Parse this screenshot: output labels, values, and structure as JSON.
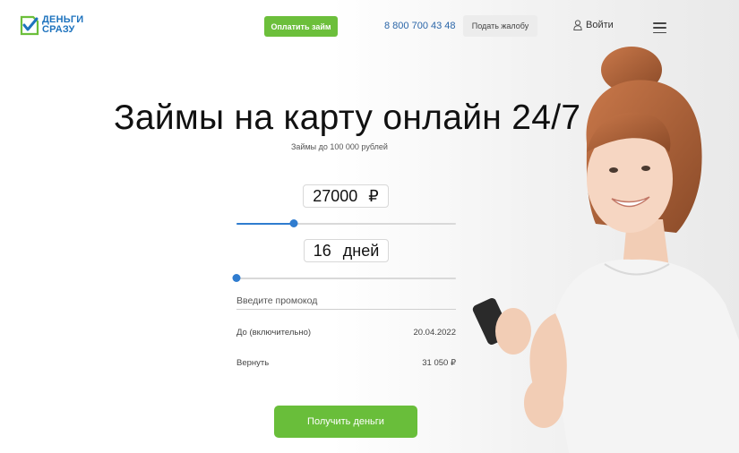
{
  "header": {
    "logo_line1": "ДЕНЬГИ",
    "logo_line2": "СРАЗУ",
    "pay_button": "Оплатить займ",
    "phone": "8 800 700 43 48",
    "complaint_button": "Подать жалобу",
    "login": "Войти"
  },
  "hero": {
    "title": "Займы на карту онлайн 24/7",
    "subtitle": "Займы до 100 000 рублей"
  },
  "calculator": {
    "amount": "27000",
    "currency": "₽",
    "amount_fraction": 0.26,
    "days": "16",
    "days_unit": "дней",
    "days_fraction": 0.0,
    "promo_placeholder": "Введите промокод",
    "due_label": "До (включительно)",
    "due_value": "20.04.2022",
    "return_label": "Вернуть",
    "return_value": "31 050 ₽",
    "submit": "Получить деньги"
  },
  "colors": {
    "accent_green": "#6cbf3b",
    "accent_blue": "#2f7ccf",
    "logo_blue": "#1e73be"
  }
}
